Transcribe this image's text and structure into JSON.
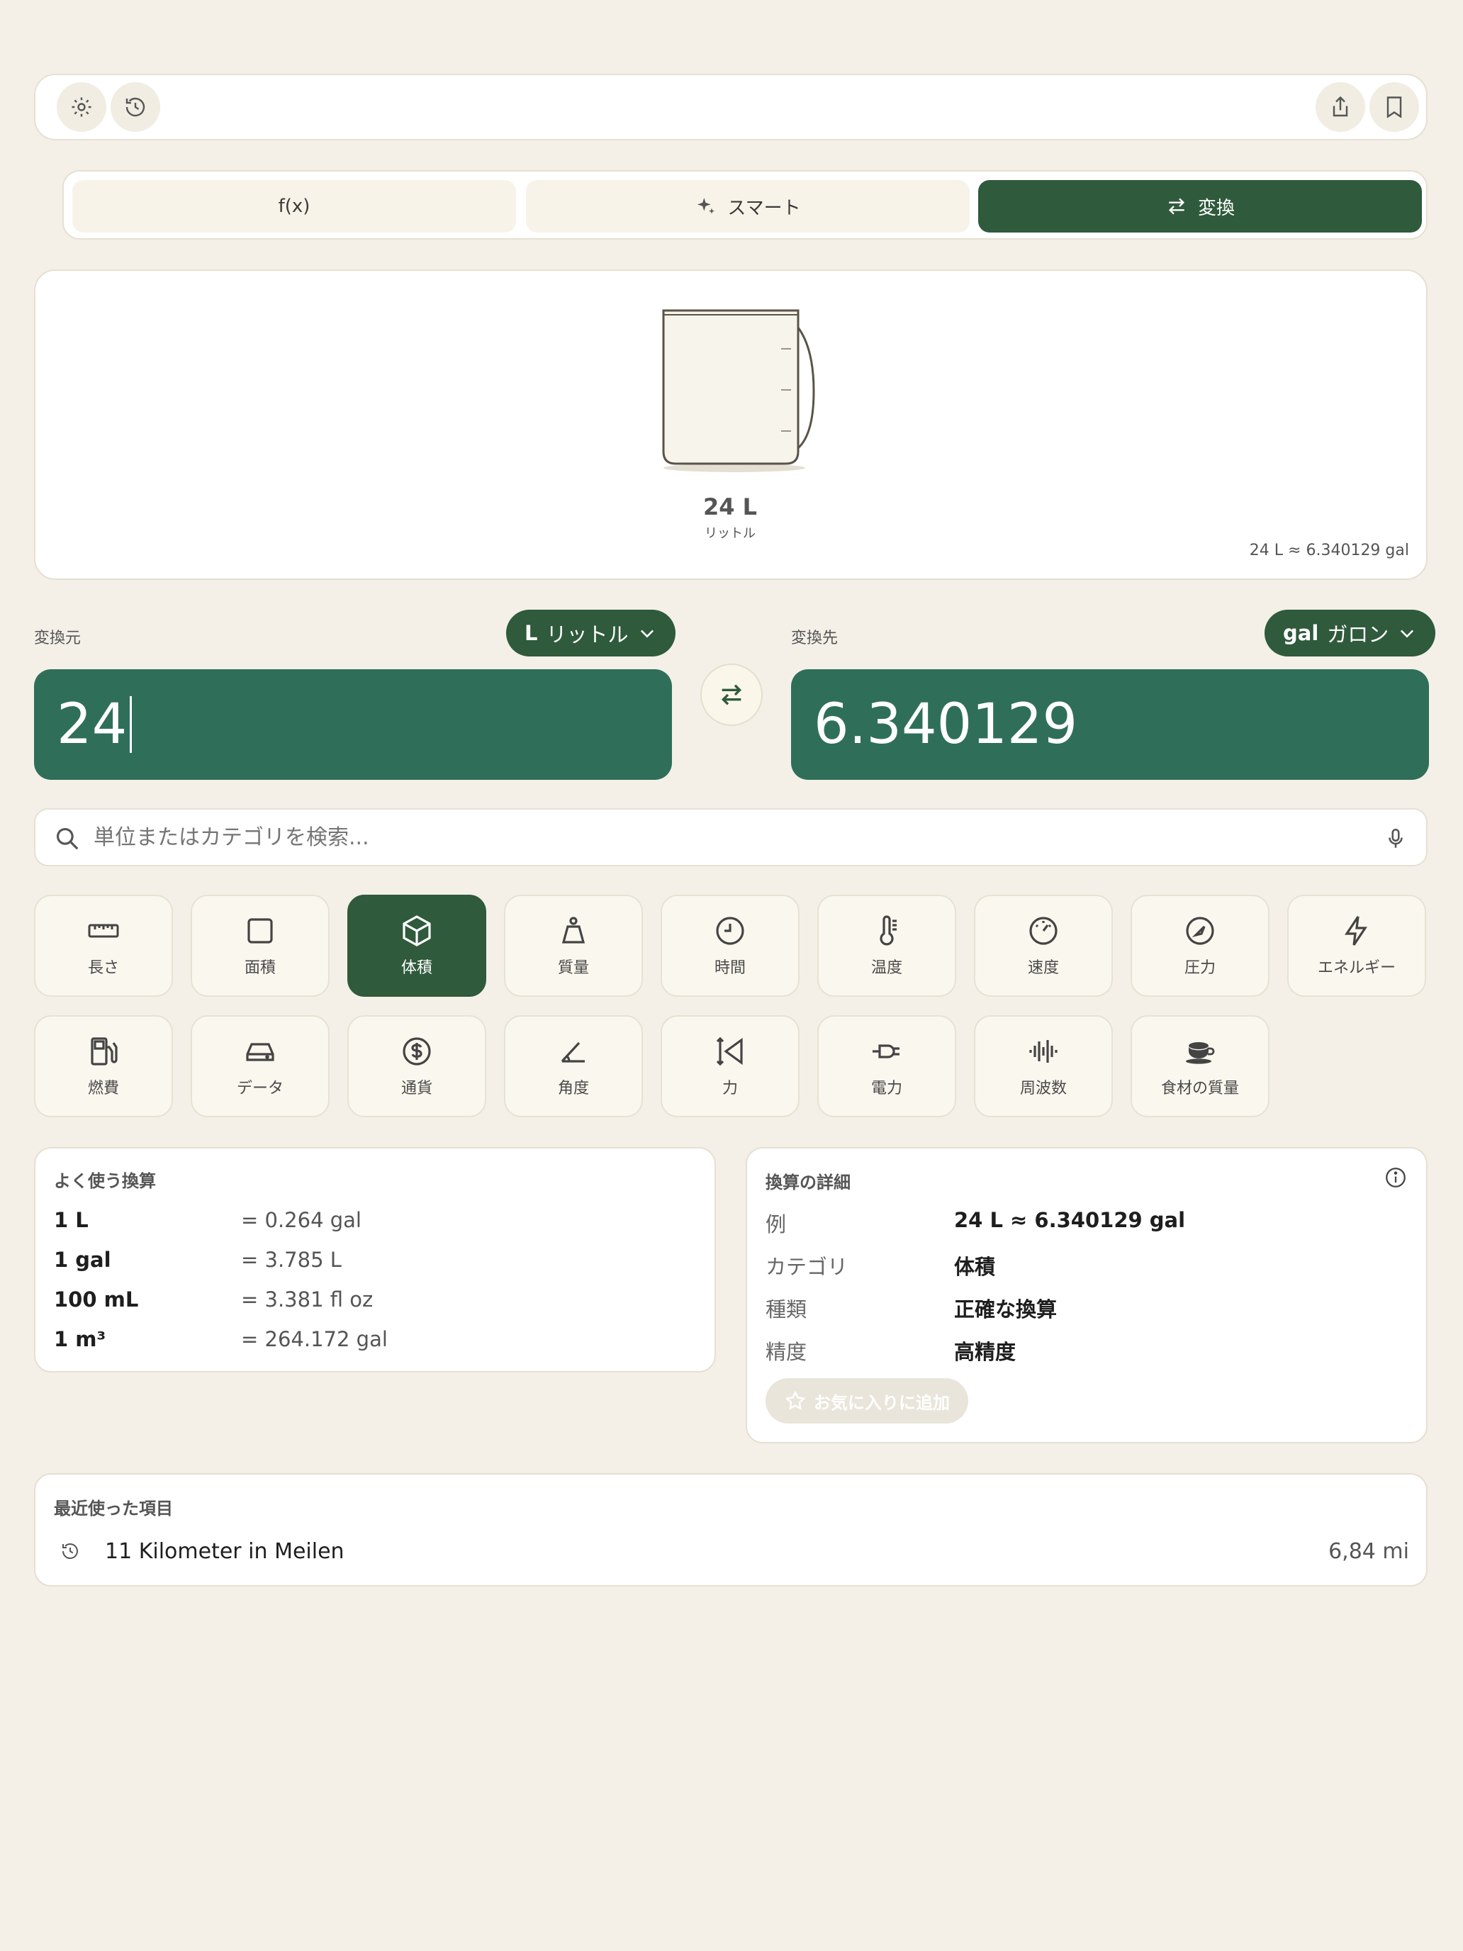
{
  "toolbar": {
    "left_icons": [
      "gear-icon",
      "history-icon"
    ],
    "right_icons": [
      "share-icon",
      "bookmark-icon"
    ]
  },
  "modes": [
    {
      "label": "f(x)",
      "icon": "",
      "active": false
    },
    {
      "label": "スマート",
      "icon": "sparkles-icon",
      "active": false
    },
    {
      "label": "変換",
      "icon": "swap-arrows-icon",
      "active": true
    }
  ],
  "illustration": {
    "value_label": "24 L",
    "unit_name": "リットル",
    "summary": "24 L ≈ 6.340129 gal"
  },
  "from": {
    "label": "変換元",
    "unit_abbr": "L",
    "unit_name": "リットル",
    "value": "24"
  },
  "to": {
    "label": "変換先",
    "unit_abbr": "gal",
    "unit_name": "ガロン",
    "value": "6.340129"
  },
  "search": {
    "placeholder": "単位またはカテゴリを検索..."
  },
  "categories": [
    {
      "label": "長さ",
      "icon": "ruler-icon",
      "active": false
    },
    {
      "label": "面積",
      "icon": "square-icon",
      "active": false
    },
    {
      "label": "体積",
      "icon": "cube-icon",
      "active": true
    },
    {
      "label": "質量",
      "icon": "weight-icon",
      "active": false
    },
    {
      "label": "時間",
      "icon": "clock-icon",
      "active": false
    },
    {
      "label": "温度",
      "icon": "thermometer-icon",
      "active": false
    },
    {
      "label": "速度",
      "icon": "speedometer-icon",
      "active": false
    },
    {
      "label": "圧力",
      "icon": "gauge-icon",
      "active": false
    },
    {
      "label": "エネルギー",
      "icon": "bolt-icon",
      "active": false
    },
    {
      "label": "燃費",
      "icon": "fuel-pump-icon",
      "active": false
    },
    {
      "label": "データ",
      "icon": "drive-icon",
      "active": false
    },
    {
      "label": "通貨",
      "icon": "dollar-icon",
      "active": false
    },
    {
      "label": "角度",
      "icon": "angle-icon",
      "active": false
    },
    {
      "label": "力",
      "icon": "force-icon",
      "active": false
    },
    {
      "label": "電力",
      "icon": "plug-icon",
      "active": false
    },
    {
      "label": "周波数",
      "icon": "waveform-icon",
      "active": false
    },
    {
      "label": "食材の質量",
      "icon": "cup-icon",
      "active": false
    }
  ],
  "common": {
    "title": "よく使う換算",
    "rows": [
      {
        "left": "1 L",
        "right": "= 0.264 gal"
      },
      {
        "left": "1 gal",
        "right": "= 3.785 L"
      },
      {
        "left": "100 mL",
        "right": "= 3.381 fl oz"
      },
      {
        "left": "1 m³",
        "right": "= 264.172 gal"
      }
    ]
  },
  "details": {
    "title": "換算の詳細",
    "rows": [
      {
        "key": "例",
        "value": "24 L ≈ 6.340129 gal"
      },
      {
        "key": "カテゴリ",
        "value": "体積"
      },
      {
        "key": "種類",
        "value": "正確な換算"
      },
      {
        "key": "精度",
        "value": "高精度"
      }
    ],
    "favorite_label": "お気に入りに追加"
  },
  "recent": {
    "title": "最近使った項目",
    "items": [
      {
        "label": "11 Kilometer in Meilen",
        "result": "6,84 mi"
      }
    ]
  },
  "colors": {
    "background": "#f4f0e8",
    "accent_dark_green": "#2f5a3c",
    "value_green": "#2f6f5a"
  }
}
